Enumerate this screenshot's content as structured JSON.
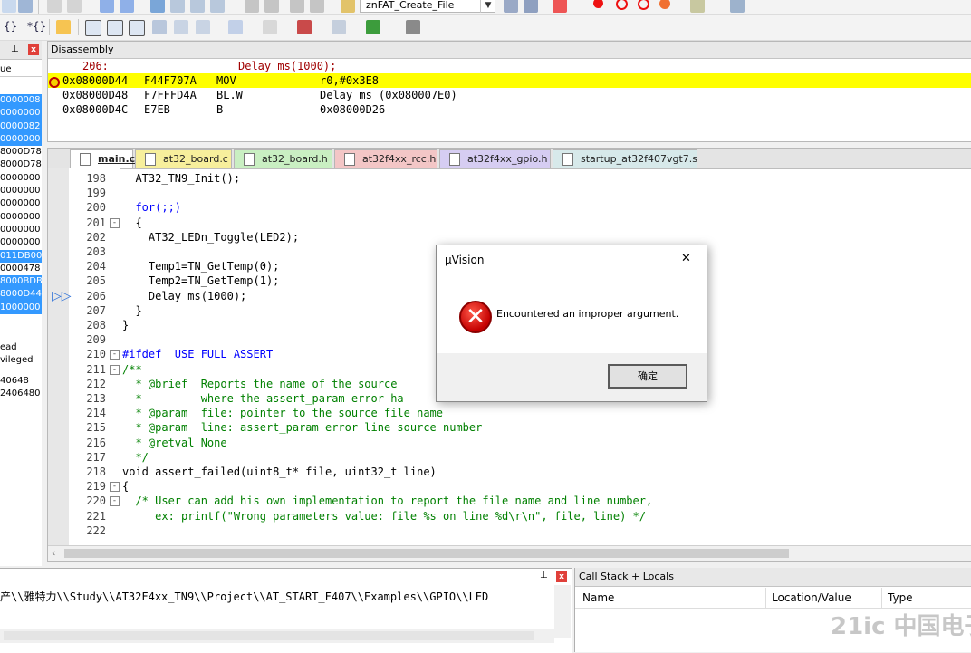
{
  "toolbar": {
    "project_target": "znFAT_Create_File"
  },
  "left_panel": {
    "header": "ue",
    "values": [
      {
        "text": "0000008",
        "selected": true
      },
      {
        "text": "0000000",
        "selected": true
      },
      {
        "text": "0000082",
        "selected": true
      },
      {
        "text": "0000000",
        "selected": true
      },
      {
        "text": "8000D78",
        "selected": false
      },
      {
        "text": "8000D78",
        "selected": false
      },
      {
        "text": "0000000",
        "selected": false
      },
      {
        "text": "0000000",
        "selected": false
      },
      {
        "text": "0000000",
        "selected": false
      },
      {
        "text": "0000000",
        "selected": false
      },
      {
        "text": "0000000",
        "selected": false
      },
      {
        "text": "0000000",
        "selected": false
      },
      {
        "text": "011DB00",
        "selected": true
      },
      {
        "text": "0000478",
        "selected": false
      },
      {
        "text": "8000BDB",
        "selected": true
      },
      {
        "text": "8000D44",
        "selected": true
      },
      {
        "text": "1000000",
        "selected": true
      }
    ],
    "mode_labels": [
      "ead",
      "vileged"
    ],
    "numbers": [
      "40648",
      "2406480"
    ]
  },
  "disassembly": {
    "title": "Disassembly",
    "rows": [
      {
        "addr": "206:",
        "opcode": "",
        "mnemonic": "",
        "operand": "Delay_ms(1000);",
        "current": false,
        "source": true
      },
      {
        "addr": "0x08000D44",
        "opcode": "F44F707A",
        "mnemonic": "MOV",
        "operand": "r0,#0x3E8",
        "current": true,
        "source": false
      },
      {
        "addr": "0x08000D48",
        "opcode": "F7FFFD4A",
        "mnemonic": "BL.W",
        "operand": "Delay_ms (0x080007E0)",
        "current": false,
        "source": false
      },
      {
        "addr": "0x08000D4C",
        "opcode": "E7EB",
        "mnemonic": "B",
        "operand": "0x08000D26",
        "current": false,
        "source": false
      }
    ]
  },
  "editor": {
    "tabs": [
      {
        "label": "main.c",
        "color": "#f3f3f3",
        "active": true
      },
      {
        "label": "at32_board.c",
        "color": "#f7ef9c",
        "active": false
      },
      {
        "label": "at32_board.h",
        "color": "#c9efc2",
        "active": false
      },
      {
        "label": "at32f4xx_rcc.h",
        "color": "#f3c6c6",
        "active": false
      },
      {
        "label": "at32f4xx_gpio.h",
        "color": "#d6cdf2",
        "active": false
      },
      {
        "label": "startup_at32f407vgt7.s",
        "color": "#d7e9ea",
        "active": false
      }
    ],
    "lines": [
      {
        "n": "198",
        "fold": "",
        "code": "  AT32_TN9_Init();",
        "cls": ""
      },
      {
        "n": "199",
        "fold": "",
        "code": "",
        "cls": ""
      },
      {
        "n": "200",
        "fold": "",
        "code": "  for(;;)",
        "cls": "kw"
      },
      {
        "n": "201",
        "fold": "-",
        "code": "  {",
        "cls": ""
      },
      {
        "n": "202",
        "fold": "",
        "code": "    AT32_LEDn_Toggle(LED2);",
        "cls": ""
      },
      {
        "n": "203",
        "fold": "",
        "code": "",
        "cls": ""
      },
      {
        "n": "204",
        "fold": "",
        "code": "    Temp1=TN_GetTemp(0);",
        "cls": ""
      },
      {
        "n": "205",
        "fold": "",
        "code": "    Temp2=TN_GetTemp(1);",
        "cls": ""
      },
      {
        "n": "206",
        "fold": "",
        "code": "    Delay_ms(1000);",
        "cls": ""
      },
      {
        "n": "207",
        "fold": "",
        "code": "  }",
        "cls": ""
      },
      {
        "n": "208",
        "fold": "",
        "code": "}",
        "cls": ""
      },
      {
        "n": "209",
        "fold": "",
        "code": "",
        "cls": ""
      },
      {
        "n": "210",
        "fold": "-",
        "code": "#ifdef  USE_FULL_ASSERT",
        "cls": "kw"
      },
      {
        "n": "211",
        "fold": "-",
        "code": "/**",
        "cls": "cm"
      },
      {
        "n": "212",
        "fold": "",
        "code": "  * @brief  Reports the name of the source",
        "cls": "cm"
      },
      {
        "n": "213",
        "fold": "",
        "code": "  *         where the assert_param error ha",
        "cls": "cm"
      },
      {
        "n": "214",
        "fold": "",
        "code": "  * @param  file: pointer to the source file name",
        "cls": "cm"
      },
      {
        "n": "215",
        "fold": "",
        "code": "  * @param  line: assert_param error line source number",
        "cls": "cm"
      },
      {
        "n": "216",
        "fold": "",
        "code": "  * @retval None",
        "cls": "cm"
      },
      {
        "n": "217",
        "fold": "",
        "code": "  */",
        "cls": "cm"
      },
      {
        "n": "218",
        "fold": "",
        "code": "void assert_failed(uint8_t* file, uint32_t line)",
        "cls": ""
      },
      {
        "n": "219",
        "fold": "-",
        "code": "{",
        "cls": ""
      },
      {
        "n": "220",
        "fold": "-",
        "code": "  /* User can add his own implementation to report the file name and line number,",
        "cls": "cm"
      },
      {
        "n": "221",
        "fold": "",
        "code": "     ex: printf(\"Wrong parameters value: file %s on line %d\\r\\n\", file, line) */",
        "cls": "cm"
      },
      {
        "n": "222",
        "fold": "",
        "code": "",
        "cls": ""
      }
    ]
  },
  "command": {
    "text": "产\\\\雅特力\\\\Study\\\\AT32F4xx_TN9\\\\Project\\\\AT_START_F407\\\\Examples\\\\GPIO\\\\LED"
  },
  "call_stack": {
    "title": "Call Stack + Locals",
    "columns": [
      "Name",
      "Location/Value",
      "Type"
    ]
  },
  "dialog": {
    "title": "µVision",
    "message": "Encountered an improper argument.",
    "ok_label": "确定",
    "close_glyph": "✕"
  },
  "watermark": "21ic 中国电子网"
}
